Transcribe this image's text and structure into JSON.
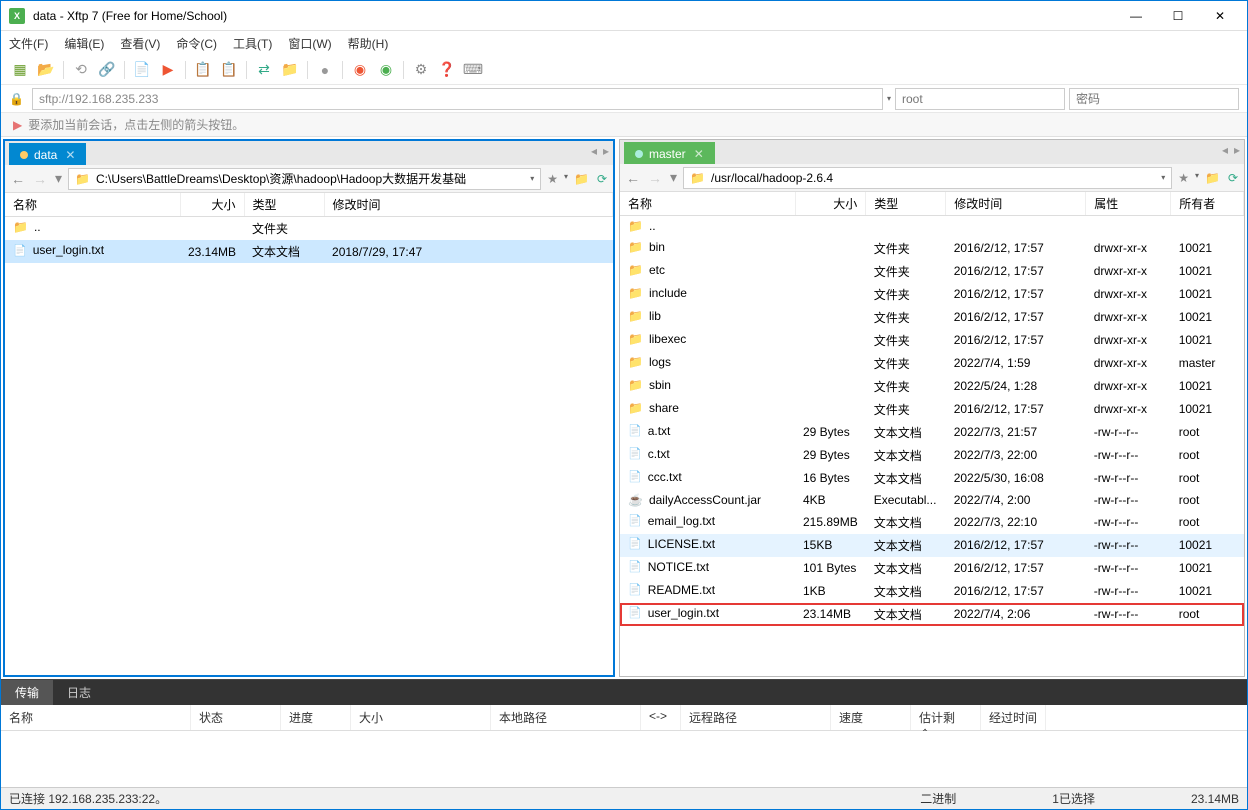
{
  "window": {
    "title": "data - Xftp 7 (Free for Home/School)"
  },
  "menu": {
    "file": "文件(F)",
    "edit": "编辑(E)",
    "view": "查看(V)",
    "commands": "命令(C)",
    "tools": "工具(T)",
    "window": "窗口(W)",
    "help": "帮助(H)"
  },
  "address": {
    "url": "sftp://192.168.235.233",
    "user_placeholder": "root",
    "pass_placeholder": "密码"
  },
  "hint": "要添加当前会话，点击左侧的箭头按钮。",
  "left_pane": {
    "tab_label": "data",
    "path": "C:\\Users\\BattleDreams\\Desktop\\资源\\hadoop\\Hadoop大数据开发基础",
    "columns": {
      "name": "名称",
      "size": "大小",
      "type": "类型",
      "modified": "修改时间"
    },
    "rows": [
      {
        "kind": "up",
        "name": ".."
      },
      {
        "kind": "file",
        "name": "user_login.txt",
        "size": "23.14MB",
        "type": "文本文档",
        "modified": "2018/7/29, 17:47",
        "selected": true
      }
    ],
    "folder_type": "文件夹"
  },
  "right_pane": {
    "tab_label": "master",
    "path": "/usr/local/hadoop-2.6.4",
    "columns": {
      "name": "名称",
      "size": "大小",
      "type": "类型",
      "modified": "修改时间",
      "attr": "属性",
      "owner": "所有者"
    },
    "rows": [
      {
        "kind": "up",
        "name": ".."
      },
      {
        "kind": "folder",
        "name": "bin",
        "type": "文件夹",
        "modified": "2016/2/12, 17:57",
        "attr": "drwxr-xr-x",
        "owner": "10021"
      },
      {
        "kind": "folder",
        "name": "etc",
        "type": "文件夹",
        "modified": "2016/2/12, 17:57",
        "attr": "drwxr-xr-x",
        "owner": "10021"
      },
      {
        "kind": "folder",
        "name": "include",
        "type": "文件夹",
        "modified": "2016/2/12, 17:57",
        "attr": "drwxr-xr-x",
        "owner": "10021"
      },
      {
        "kind": "folder",
        "name": "lib",
        "type": "文件夹",
        "modified": "2016/2/12, 17:57",
        "attr": "drwxr-xr-x",
        "owner": "10021"
      },
      {
        "kind": "folder",
        "name": "libexec",
        "type": "文件夹",
        "modified": "2016/2/12, 17:57",
        "attr": "drwxr-xr-x",
        "owner": "10021"
      },
      {
        "kind": "folder",
        "name": "logs",
        "type": "文件夹",
        "modified": "2022/7/4, 1:59",
        "attr": "drwxr-xr-x",
        "owner": "master"
      },
      {
        "kind": "folder",
        "name": "sbin",
        "type": "文件夹",
        "modified": "2022/5/24, 1:28",
        "attr": "drwxr-xr-x",
        "owner": "10021"
      },
      {
        "kind": "folder",
        "name": "share",
        "type": "文件夹",
        "modified": "2016/2/12, 17:57",
        "attr": "drwxr-xr-x",
        "owner": "10021"
      },
      {
        "kind": "file",
        "name": "a.txt",
        "size": "29 Bytes",
        "type": "文本文档",
        "modified": "2022/7/3, 21:57",
        "attr": "-rw-r--r--",
        "owner": "root"
      },
      {
        "kind": "file",
        "name": "c.txt",
        "size": "29 Bytes",
        "type": "文本文档",
        "modified": "2022/7/3, 22:00",
        "attr": "-rw-r--r--",
        "owner": "root"
      },
      {
        "kind": "file",
        "name": "ccc.txt",
        "size": "16 Bytes",
        "type": "文本文档",
        "modified": "2022/5/30, 16:08",
        "attr": "-rw-r--r--",
        "owner": "root"
      },
      {
        "kind": "jar",
        "name": "dailyAccessCount.jar",
        "size": "4KB",
        "type": "Executabl...",
        "modified": "2022/7/4, 2:00",
        "attr": "-rw-r--r--",
        "owner": "root"
      },
      {
        "kind": "file",
        "name": "email_log.txt",
        "size": "215.89MB",
        "type": "文本文档",
        "modified": "2022/7/3, 22:10",
        "attr": "-rw-r--r--",
        "owner": "root"
      },
      {
        "kind": "file",
        "name": "LICENSE.txt",
        "size": "15KB",
        "type": "文本文档",
        "modified": "2016/2/12, 17:57",
        "attr": "-rw-r--r--",
        "owner": "10021",
        "hover": true
      },
      {
        "kind": "file",
        "name": "NOTICE.txt",
        "size": "101 Bytes",
        "type": "文本文档",
        "modified": "2016/2/12, 17:57",
        "attr": "-rw-r--r--",
        "owner": "10021"
      },
      {
        "kind": "file",
        "name": "README.txt",
        "size": "1KB",
        "type": "文本文档",
        "modified": "2016/2/12, 17:57",
        "attr": "-rw-r--r--",
        "owner": "10021"
      },
      {
        "kind": "file",
        "name": "user_login.txt",
        "size": "23.14MB",
        "type": "文本文档",
        "modified": "2022/7/4, 2:06",
        "attr": "-rw-r--r--",
        "owner": "root",
        "highlight": true
      }
    ]
  },
  "bottom_tabs": {
    "transfer": "传输",
    "log": "日志"
  },
  "transfer_cols": {
    "name": "名称",
    "status": "状态",
    "progress": "进度",
    "size": "大小",
    "local": "本地路径",
    "arrow": "<->",
    "remote": "远程路径",
    "speed": "速度",
    "eta": "估计剩余...",
    "elapsed": "经过时间"
  },
  "status": {
    "connected": "已连接 192.168.235.233:22。",
    "binary": "二进制",
    "selected": "1已选择",
    "size": "23.14MB"
  }
}
